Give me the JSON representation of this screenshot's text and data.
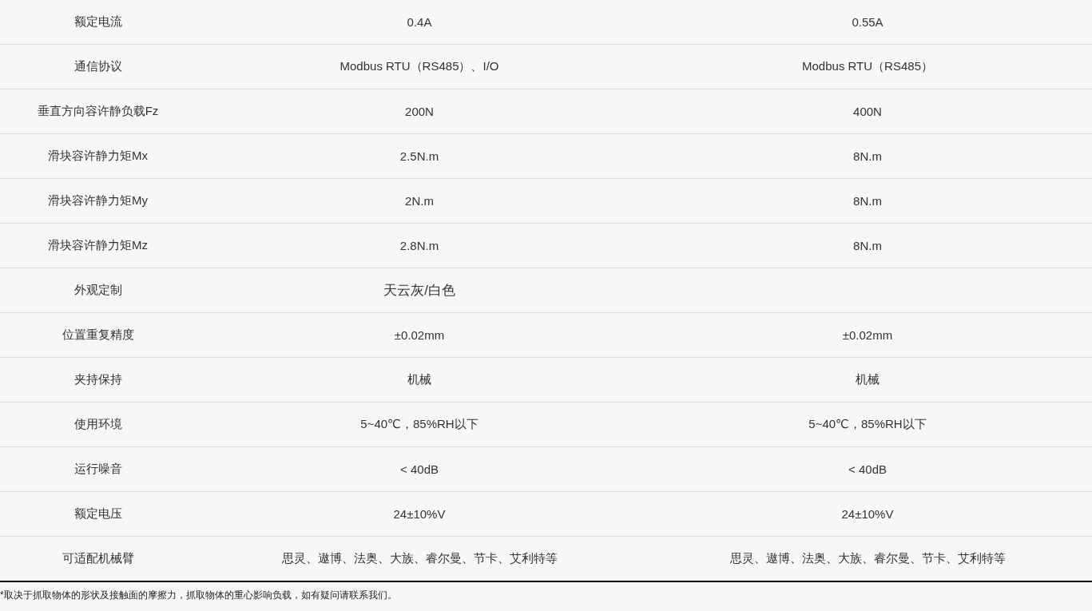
{
  "table": {
    "rows": [
      {
        "cells": [
          "额定电流",
          "0.4A",
          "0.55A"
        ]
      },
      {
        "cells": [
          "通信协议",
          "Modbus RTU（RS485）、I/O",
          "Modbus RTU（RS485）"
        ]
      },
      {
        "cells": [
          "垂直方向容许静负载Fz",
          "200N",
          "400N"
        ]
      },
      {
        "cells": [
          "滑块容许静力矩Mx",
          "2.5N.m",
          "8N.m"
        ]
      },
      {
        "cells": [
          "滑块容许静力矩My",
          "2N.m",
          "8N.m"
        ]
      },
      {
        "cells": [
          "滑块容许静力矩Mz",
          "2.8N.m",
          "8N.m"
        ]
      },
      {
        "cells": [
          "外观定制",
          "天云灰/白色"
        ]
      },
      {
        "cells": [
          "位置重复精度",
          "±0.02mm",
          "±0.02mm"
        ]
      },
      {
        "cells": [
          "夹持保持",
          "机械",
          "机械"
        ]
      },
      {
        "cells": [
          "使用环境",
          "5~40℃，85%RH以下",
          "5~40℃，85%RH以下"
        ]
      },
      {
        "cells": [
          "运行噪音",
          "< 40dB",
          "< 40dB"
        ]
      },
      {
        "cells": [
          "额定电压",
          "24±10%V",
          "24±10%V"
        ]
      },
      {
        "cells": [
          "可适配机械臂",
          "思灵、遨博、法奥、大族、睿尔曼、节卡、艾利特等",
          "思灵、遨博、法奥、大族、睿尔曼、节卡、艾利特等"
        ]
      }
    ]
  },
  "footnote": "*取决于抓取物体的形状及接触面的摩擦力，抓取物体的重心影响负载，如有疑问请联系我们。"
}
